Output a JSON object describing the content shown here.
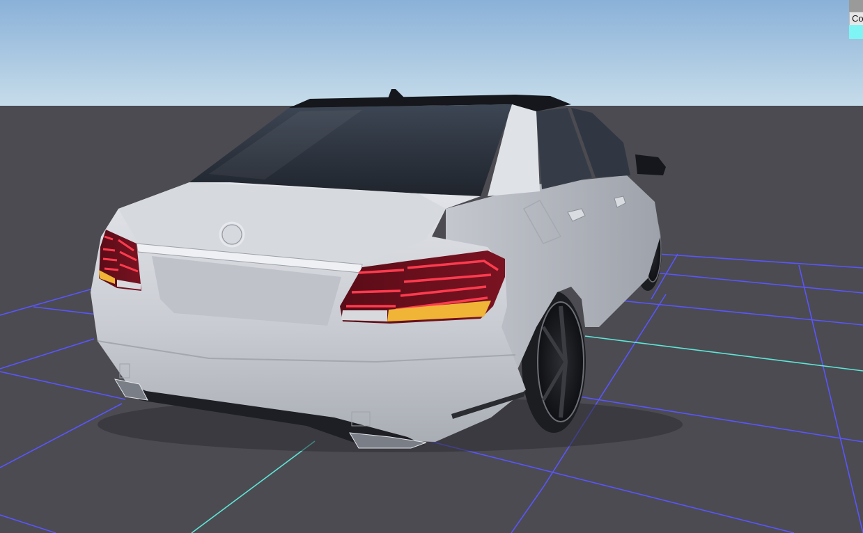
{
  "viewport": {
    "sky_top_color": "#8ab1d8",
    "sky_horizon_color": "#c6dcea",
    "ground_color": "#4b4b51",
    "grid_line_color": "#5a55ff",
    "grid_axis_color": "#5ee6d8"
  },
  "car": {
    "body_color": "#c9ccd2",
    "glass_color": "#2a3039",
    "tail_light_color": "#d8283c",
    "indicator_color": "#f0b437",
    "tire_color": "#1c1d21"
  },
  "corner_panel": {
    "button_label": "Co",
    "swatch_color": "#7ff4f4"
  }
}
